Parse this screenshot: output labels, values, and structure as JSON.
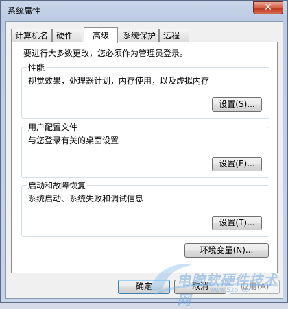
{
  "window": {
    "title": "系统属性",
    "close_glyph": "✕"
  },
  "tabs": [
    {
      "label": "计算机名"
    },
    {
      "label": "硬件"
    },
    {
      "label": "高级"
    },
    {
      "label": "系统保护"
    },
    {
      "label": "远程"
    }
  ],
  "active_tab": "高级",
  "advanced": {
    "intro": "要进行大多数更改，您必须作为管理员登录。",
    "performance": {
      "title": "性能",
      "description": "视觉效果，处理器计划，内存使用，以及虚拟内存",
      "button": "设置(S)..."
    },
    "user_profiles": {
      "title": "用户配置文件",
      "description": "与您登录有关的桌面设置",
      "button": "设置(E)..."
    },
    "startup_recovery": {
      "title": "启动和故障恢复",
      "description": "系统启动、系统失败和调试信息",
      "button": "设置(T)..."
    },
    "env_button": "环境变量(N)..."
  },
  "footer": {
    "ok": "确定",
    "cancel": "取消",
    "apply": "应用(A)"
  },
  "watermark": {
    "text": "电脑软硬件技术网",
    "url": "www.52pj.com"
  }
}
